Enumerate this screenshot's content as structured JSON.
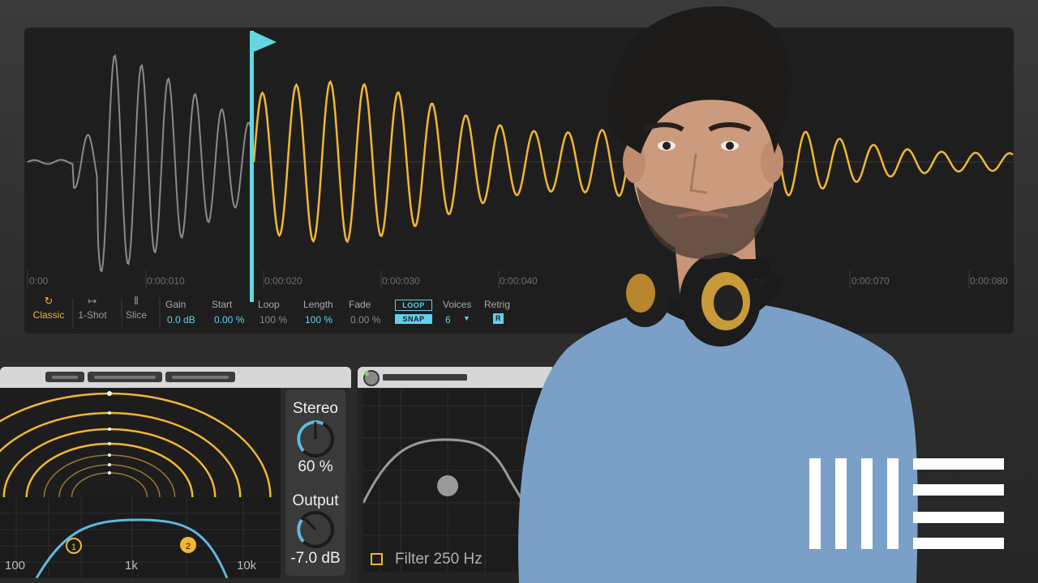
{
  "sampler": {
    "time_ruler": [
      "0:00",
      "0:00:010",
      "0:00:020",
      "0:00:030",
      "0:00:040",
      "0:00:070",
      "0:00:080"
    ],
    "modes": [
      {
        "label": "Classic",
        "icon": "loop-arrow-icon",
        "active": true
      },
      {
        "label": "1-Shot",
        "icon": "arrow-to-bar-icon",
        "active": false
      },
      {
        "label": "Slice",
        "icon": "slice-bars-icon",
        "active": false
      }
    ],
    "controls": {
      "gain": {
        "label": "Gain",
        "value": "0.0 dB"
      },
      "start": {
        "label": "Start",
        "value": "0.00 %"
      },
      "loop": {
        "label": "Loop",
        "value": "100 %"
      },
      "length": {
        "label": "Length",
        "value": "100 %"
      },
      "fade": {
        "label": "Fade",
        "value": "0.00 %"
      },
      "voices": {
        "label": "Voices",
        "value": "6"
      },
      "retrig": {
        "label": "Retrig",
        "value": "R"
      }
    },
    "loop_toggle": "LOOP",
    "snap_toggle": "SNAP",
    "start_marker_icon": "flag-icon",
    "colors": {
      "active_wave": "#f2b635",
      "inactive_wave": "#8a8a8a",
      "marker": "#5fd8e0",
      "accent_value": "#5fd0f0"
    }
  },
  "eq_device": {
    "stereo_label": "Stereo",
    "stereo_value": "60 %",
    "stereo_level": 0.6,
    "output_label": "Output",
    "output_value": "-7.0 dB",
    "freq_labels": [
      "100",
      "1k",
      "10k"
    ],
    "band_1": "1",
    "band_2": "2",
    "colors": {
      "arcs": "#f2b635",
      "curve": "#5fb8e0"
    }
  },
  "filter_device": {
    "label": "Filter 250 Hz"
  },
  "logo_icon": "ableton-logo-icon"
}
